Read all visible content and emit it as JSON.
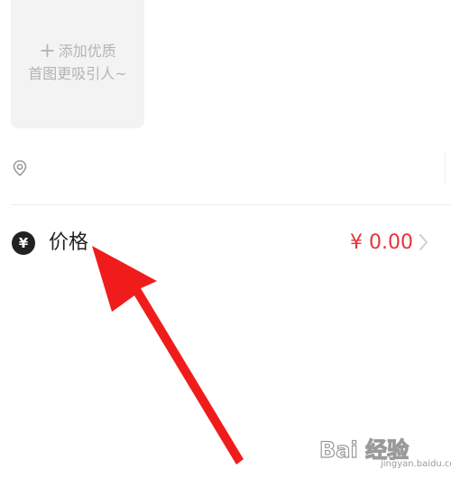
{
  "photo_upload": {
    "plus_icon": "plus-icon",
    "line1": "添加优质",
    "line2": "首图更吸引人~"
  },
  "location": {
    "icon": "location-pin-icon"
  },
  "price": {
    "icon": "yen-badge-icon",
    "badge_symbol": "¥",
    "label": "价格",
    "value": "¥ 0.00",
    "chevron_icon": "chevron-right-icon"
  },
  "annotation": {
    "arrow_icon": "red-arrow-icon"
  },
  "watermark": {
    "brand": "Bai 经验",
    "url": "jingyan.baidu.com"
  },
  "colors": {
    "accent_red": "#e8323c",
    "arrow_red": "#f01c1c",
    "text_dark": "#222222",
    "placeholder_gray": "#b4b4b4",
    "tile_bg": "#f3f3f3"
  }
}
